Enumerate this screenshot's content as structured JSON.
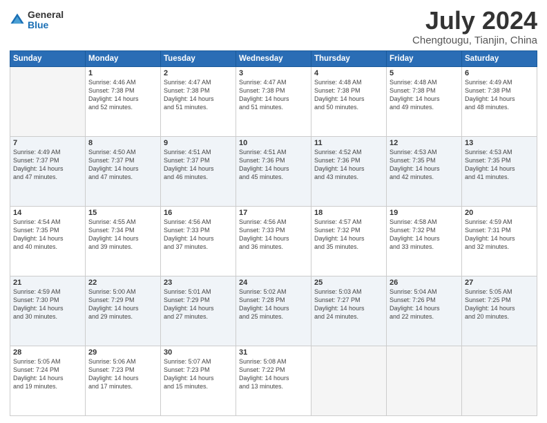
{
  "header": {
    "logo_general": "General",
    "logo_blue": "Blue",
    "month_year": "July 2024",
    "location": "Chengtougu, Tianjin, China"
  },
  "weekdays": [
    "Sunday",
    "Monday",
    "Tuesday",
    "Wednesday",
    "Thursday",
    "Friday",
    "Saturday"
  ],
  "weeks": [
    [
      {
        "day": "",
        "text": ""
      },
      {
        "day": "1",
        "text": "Sunrise: 4:46 AM\nSunset: 7:38 PM\nDaylight: 14 hours\nand 52 minutes."
      },
      {
        "day": "2",
        "text": "Sunrise: 4:47 AM\nSunset: 7:38 PM\nDaylight: 14 hours\nand 51 minutes."
      },
      {
        "day": "3",
        "text": "Sunrise: 4:47 AM\nSunset: 7:38 PM\nDaylight: 14 hours\nand 51 minutes."
      },
      {
        "day": "4",
        "text": "Sunrise: 4:48 AM\nSunset: 7:38 PM\nDaylight: 14 hours\nand 50 minutes."
      },
      {
        "day": "5",
        "text": "Sunrise: 4:48 AM\nSunset: 7:38 PM\nDaylight: 14 hours\nand 49 minutes."
      },
      {
        "day": "6",
        "text": "Sunrise: 4:49 AM\nSunset: 7:38 PM\nDaylight: 14 hours\nand 48 minutes."
      }
    ],
    [
      {
        "day": "7",
        "text": "Sunrise: 4:49 AM\nSunset: 7:37 PM\nDaylight: 14 hours\nand 47 minutes."
      },
      {
        "day": "8",
        "text": "Sunrise: 4:50 AM\nSunset: 7:37 PM\nDaylight: 14 hours\nand 47 minutes."
      },
      {
        "day": "9",
        "text": "Sunrise: 4:51 AM\nSunset: 7:37 PM\nDaylight: 14 hours\nand 46 minutes."
      },
      {
        "day": "10",
        "text": "Sunrise: 4:51 AM\nSunset: 7:36 PM\nDaylight: 14 hours\nand 45 minutes."
      },
      {
        "day": "11",
        "text": "Sunrise: 4:52 AM\nSunset: 7:36 PM\nDaylight: 14 hours\nand 43 minutes."
      },
      {
        "day": "12",
        "text": "Sunrise: 4:53 AM\nSunset: 7:35 PM\nDaylight: 14 hours\nand 42 minutes."
      },
      {
        "day": "13",
        "text": "Sunrise: 4:53 AM\nSunset: 7:35 PM\nDaylight: 14 hours\nand 41 minutes."
      }
    ],
    [
      {
        "day": "14",
        "text": "Sunrise: 4:54 AM\nSunset: 7:35 PM\nDaylight: 14 hours\nand 40 minutes."
      },
      {
        "day": "15",
        "text": "Sunrise: 4:55 AM\nSunset: 7:34 PM\nDaylight: 14 hours\nand 39 minutes."
      },
      {
        "day": "16",
        "text": "Sunrise: 4:56 AM\nSunset: 7:33 PM\nDaylight: 14 hours\nand 37 minutes."
      },
      {
        "day": "17",
        "text": "Sunrise: 4:56 AM\nSunset: 7:33 PM\nDaylight: 14 hours\nand 36 minutes."
      },
      {
        "day": "18",
        "text": "Sunrise: 4:57 AM\nSunset: 7:32 PM\nDaylight: 14 hours\nand 35 minutes."
      },
      {
        "day": "19",
        "text": "Sunrise: 4:58 AM\nSunset: 7:32 PM\nDaylight: 14 hours\nand 33 minutes."
      },
      {
        "day": "20",
        "text": "Sunrise: 4:59 AM\nSunset: 7:31 PM\nDaylight: 14 hours\nand 32 minutes."
      }
    ],
    [
      {
        "day": "21",
        "text": "Sunrise: 4:59 AM\nSunset: 7:30 PM\nDaylight: 14 hours\nand 30 minutes."
      },
      {
        "day": "22",
        "text": "Sunrise: 5:00 AM\nSunset: 7:29 PM\nDaylight: 14 hours\nand 29 minutes."
      },
      {
        "day": "23",
        "text": "Sunrise: 5:01 AM\nSunset: 7:29 PM\nDaylight: 14 hours\nand 27 minutes."
      },
      {
        "day": "24",
        "text": "Sunrise: 5:02 AM\nSunset: 7:28 PM\nDaylight: 14 hours\nand 25 minutes."
      },
      {
        "day": "25",
        "text": "Sunrise: 5:03 AM\nSunset: 7:27 PM\nDaylight: 14 hours\nand 24 minutes."
      },
      {
        "day": "26",
        "text": "Sunrise: 5:04 AM\nSunset: 7:26 PM\nDaylight: 14 hours\nand 22 minutes."
      },
      {
        "day": "27",
        "text": "Sunrise: 5:05 AM\nSunset: 7:25 PM\nDaylight: 14 hours\nand 20 minutes."
      }
    ],
    [
      {
        "day": "28",
        "text": "Sunrise: 5:05 AM\nSunset: 7:24 PM\nDaylight: 14 hours\nand 19 minutes."
      },
      {
        "day": "29",
        "text": "Sunrise: 5:06 AM\nSunset: 7:23 PM\nDaylight: 14 hours\nand 17 minutes."
      },
      {
        "day": "30",
        "text": "Sunrise: 5:07 AM\nSunset: 7:23 PM\nDaylight: 14 hours\nand 15 minutes."
      },
      {
        "day": "31",
        "text": "Sunrise: 5:08 AM\nSunset: 7:22 PM\nDaylight: 14 hours\nand 13 minutes."
      },
      {
        "day": "",
        "text": ""
      },
      {
        "day": "",
        "text": ""
      },
      {
        "day": "",
        "text": ""
      }
    ]
  ]
}
